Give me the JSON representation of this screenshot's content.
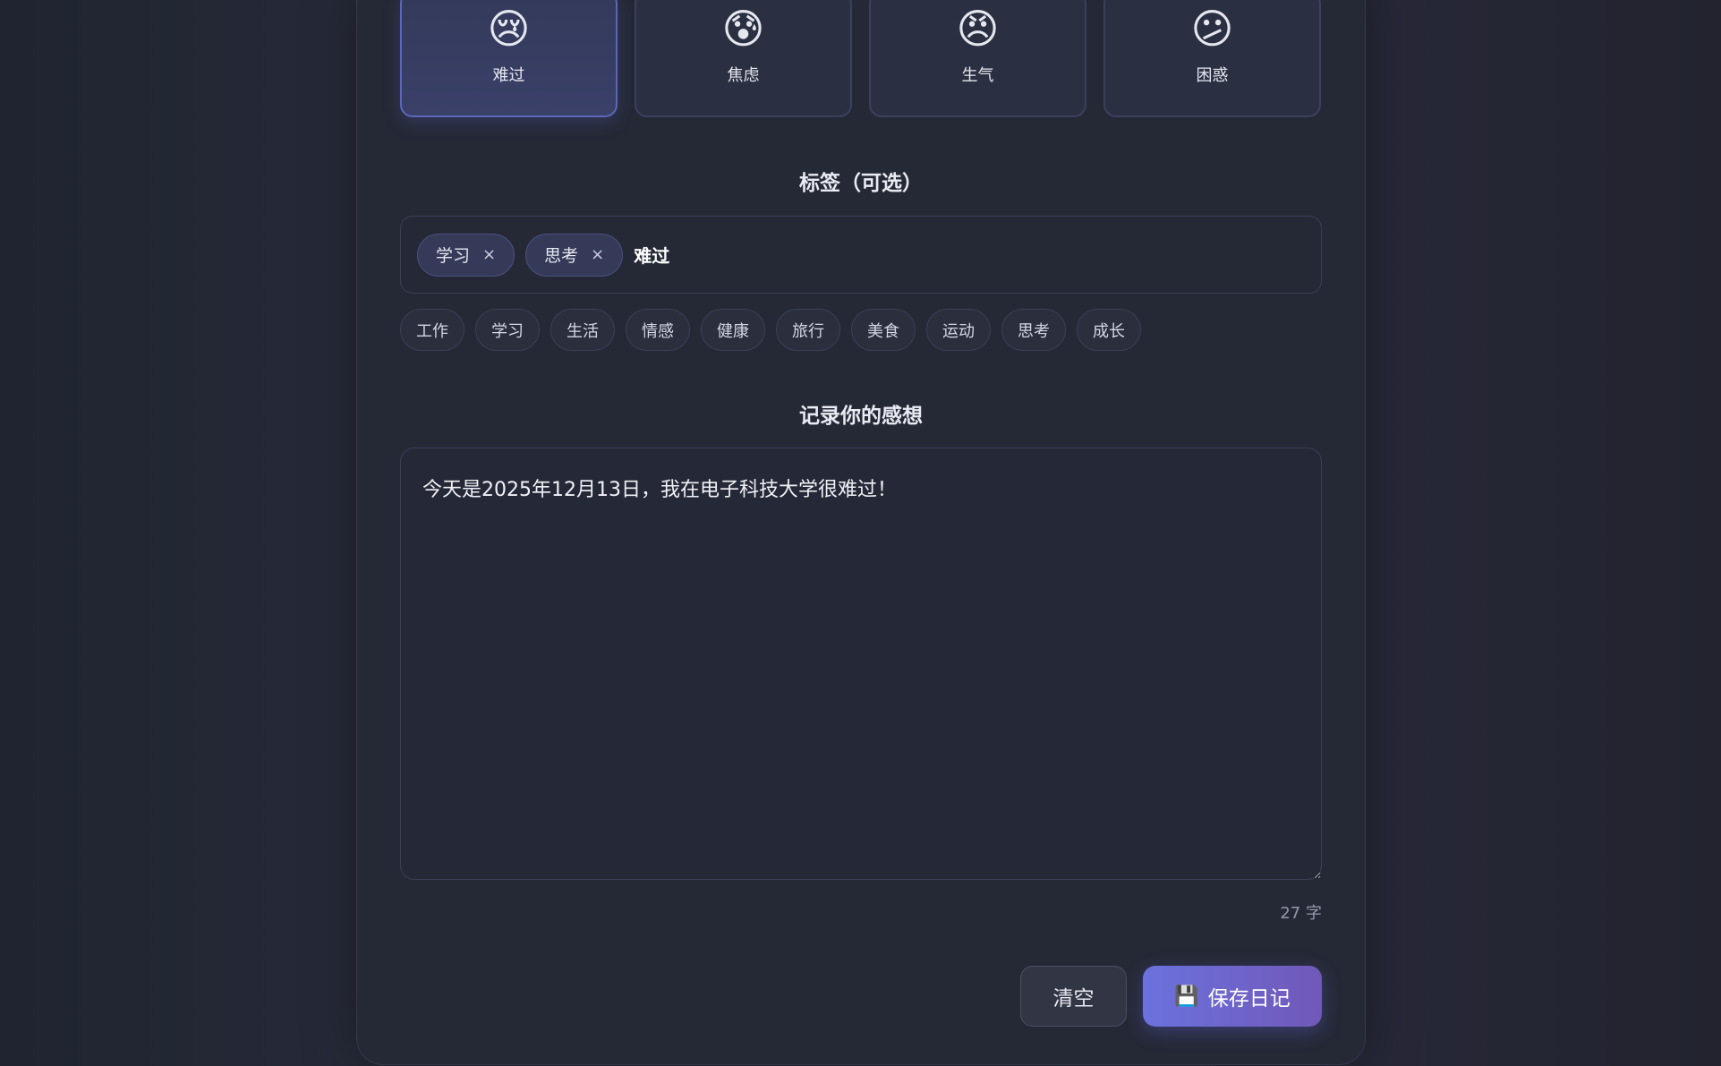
{
  "moods": [
    {
      "emoji": "😢",
      "icon": "sad-face-icon",
      "label": "难过",
      "selected": true
    },
    {
      "emoji": "😰",
      "icon": "anxious-face-icon",
      "label": "焦虑",
      "selected": false
    },
    {
      "emoji": "😠",
      "icon": "angry-face-icon",
      "label": "生气",
      "selected": false
    },
    {
      "emoji": "😕",
      "icon": "confused-face-icon",
      "label": "困惑",
      "selected": false
    }
  ],
  "tags": {
    "title": "标签（可选）",
    "selected": [
      {
        "label": "学习",
        "remove": "×"
      },
      {
        "label": "思考",
        "remove": "×"
      }
    ],
    "input_value": "难过",
    "suggested": [
      "工作",
      "学习",
      "生活",
      "情感",
      "健康",
      "旅行",
      "美食",
      "运动",
      "思考",
      "成长"
    ]
  },
  "entry": {
    "title": "记录你的感想",
    "content": "今天是2025年12月13日，我在电子科技大学很难过！",
    "char_count": "27 字"
  },
  "actions": {
    "clear_label": "清空",
    "save_icon": "💾",
    "save_label": "保存日记"
  },
  "colors": {
    "accent_start": "#6b72de",
    "accent_end": "#7158b8",
    "background": "#252936"
  }
}
